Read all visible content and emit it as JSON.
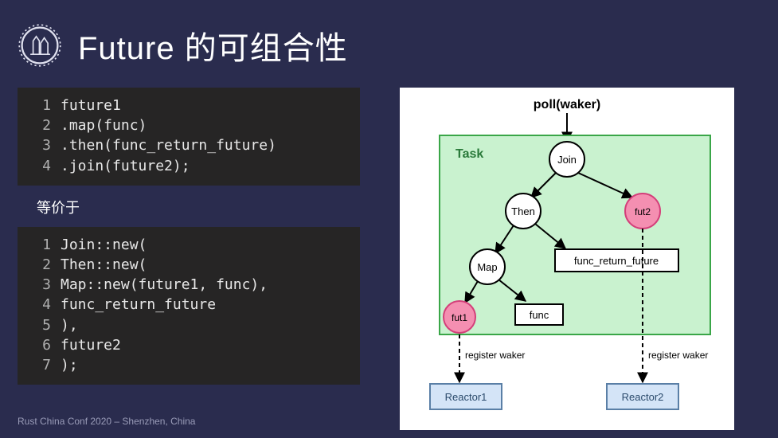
{
  "title": "Future 的可组合性",
  "code1": {
    "lines": [
      "future1",
      "  .map(func)",
      "  .then(func_return_future)",
      "  .join(future2);"
    ]
  },
  "between_label": "等价于",
  "code2": {
    "lines": [
      "Join::new(",
      "  Then::new(",
      "    Map::new(future1, func),",
      "     func_return_future",
      "  ),",
      "  future2",
      ");"
    ]
  },
  "diagram": {
    "poll_label": "poll(waker)",
    "task_label": "Task",
    "nodes": {
      "join": "Join",
      "then": "Then",
      "fut2": "fut2",
      "map": "Map",
      "frf": "func_return_future",
      "fut1": "fut1",
      "func": "func"
    },
    "edge_labels": {
      "rw1": "register waker",
      "rw2": "register waker"
    },
    "reactors": {
      "r1": "Reactor1",
      "r2": "Reactor2"
    }
  },
  "footer": "Rust China Conf 2020 – Shenzhen, China",
  "colors": {
    "task_bg": "#c9f2cf",
    "pink": "#f48fb1",
    "reactor_bg": "#d4e4f7"
  }
}
